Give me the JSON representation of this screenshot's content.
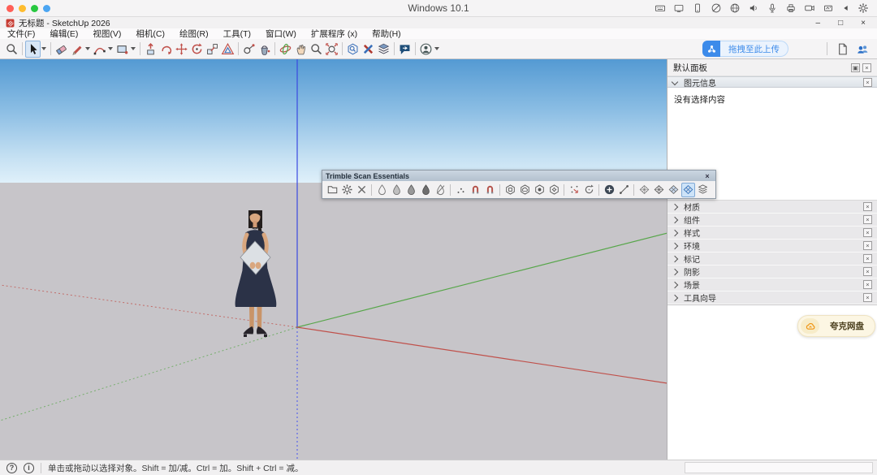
{
  "vm_bar": {
    "title": "Windows 10.1",
    "icons": [
      "keyboard-icon",
      "display-icon",
      "phone-icon",
      "network-off-icon",
      "globe-icon",
      "speaker-icon",
      "microphone-icon",
      "printer-icon",
      "camera-icon",
      "screenshot-icon",
      "play-icon",
      "gear-icon"
    ]
  },
  "titlebar": {
    "title": "无标题 - SketchUp 2026"
  },
  "glyphs": {
    "close": "×",
    "minimize": "–",
    "maximize": "□",
    "pin": "▣",
    "help": "?",
    "info": "i"
  },
  "menubar": {
    "items": [
      "文件(F)",
      "编辑(E)",
      "视图(V)",
      "相机(C)",
      "绘图(R)",
      "工具(T)",
      "窗口(W)",
      "扩展程序 (x)",
      "帮助(H)"
    ]
  },
  "toolbar": {
    "tools": [
      "zoom",
      "select",
      "eraser",
      "line",
      "arc",
      "rectangle",
      "push-pull",
      "follow-me",
      "move",
      "rotate",
      "scale",
      "offset",
      "tape-measure",
      "paint-bucket",
      "orbit",
      "pan",
      "zoom-window",
      "zoom-extents",
      "search-3d-warehouse",
      "extension-warehouse",
      "layers",
      "feedback",
      "account"
    ],
    "active_tool": "select",
    "upload_button": {
      "label": "拖拽至此上传"
    }
  },
  "trimble": {
    "title": "Trimble Scan Essentials",
    "icons": [
      "folder-icon",
      "settings-icon",
      "clear-icon",
      "point-cloud-empty-icon",
      "point-cloud-quarter-icon",
      "point-cloud-half-icon",
      "point-cloud-full-icon",
      "point-cloud-disabled-icon",
      "points-icon",
      "magnet-icon",
      "magnet-alt-icon",
      "hex-box-icon",
      "hex-cloud-icon",
      "hex-point-icon",
      "hex-gear-icon",
      "register-points-icon",
      "refresh-points-icon",
      "add-icon",
      "polyline-icon",
      "mesh-wire-icon",
      "mesh-dense-icon",
      "mesh-shaded-icon",
      "mesh-active-icon",
      "layers-stack-icon"
    ]
  },
  "panel": {
    "title": "默认面板",
    "entity_info": {
      "label": "图元信息",
      "empty_text": "没有选择内容"
    },
    "sections": [
      {
        "label": "材质"
      },
      {
        "label": "组件"
      },
      {
        "label": "样式"
      },
      {
        "label": "环境"
      },
      {
        "label": "标记"
      },
      {
        "label": "阴影"
      },
      {
        "label": "场景"
      },
      {
        "label": "工具向导"
      }
    ]
  },
  "quark": {
    "label": "夸克网盘"
  },
  "statusbar": {
    "hint": "单击或拖动以选择对象。Shift = 加/减。Ctrl = 加。Shift + Ctrl = 减。"
  },
  "colors": {
    "accent_blue": "#3D8BEA",
    "axis_red": "#C0504A",
    "axis_green": "#57A64A",
    "axis_blue": "#3A49E0",
    "sky_top": "#549AD3",
    "sky_bottom": "#DFF0FA",
    "ground": "#C7C5C9",
    "quark_orange": "#F0930F",
    "traffic_lights": [
      "#FF5F57",
      "#FEBC2E",
      "#28C840",
      "#4BA5F2"
    ]
  }
}
